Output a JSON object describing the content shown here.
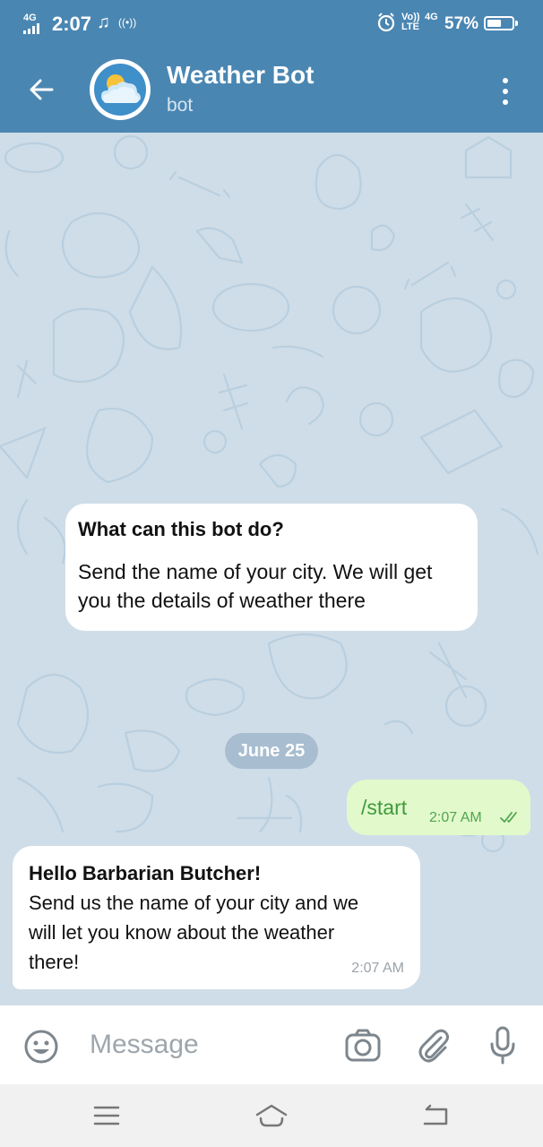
{
  "status_bar": {
    "network": "4G",
    "time": "2:07",
    "volte_top": "Vo))",
    "volte_bottom": "LTE",
    "data_type": "4G",
    "battery_percent": "57%",
    "battery_level": 0.57
  },
  "header": {
    "title": "Weather Bot",
    "subtitle": "bot"
  },
  "info_card": {
    "title": "What can this bot do?",
    "lines": [
      "Send the name of your city. We will get",
      "you the details of weather there"
    ]
  },
  "date_separator": "June 25",
  "messages": [
    {
      "direction": "outgoing",
      "text": "/start",
      "time": "2:07 AM",
      "status": "read"
    },
    {
      "direction": "incoming",
      "lines": [
        "Hello Barbarian Butcher!",
        "Send us the name of your city and we",
        "will let you know about the weather",
        "there!"
      ],
      "time": "2:07 AM"
    }
  ],
  "composer": {
    "placeholder": "Message",
    "value": ""
  },
  "icons": {
    "back": "arrow-left-icon",
    "avatar": "cloud-sun-icon",
    "menu": "more-vertical-icon",
    "emoji": "smiley-icon",
    "camera": "camera-icon",
    "attach": "paperclip-icon",
    "mic": "microphone-icon",
    "nav_recents": "recents-icon",
    "nav_home": "home-icon",
    "nav_back": "nav-back-icon"
  },
  "colors": {
    "header": "#4a86b2",
    "chat_background": "#cfdde8",
    "outgoing_bubble": "#e2f9cb",
    "outgoing_text": "#3e9b3e",
    "date_pill": "#a8bdcf"
  }
}
